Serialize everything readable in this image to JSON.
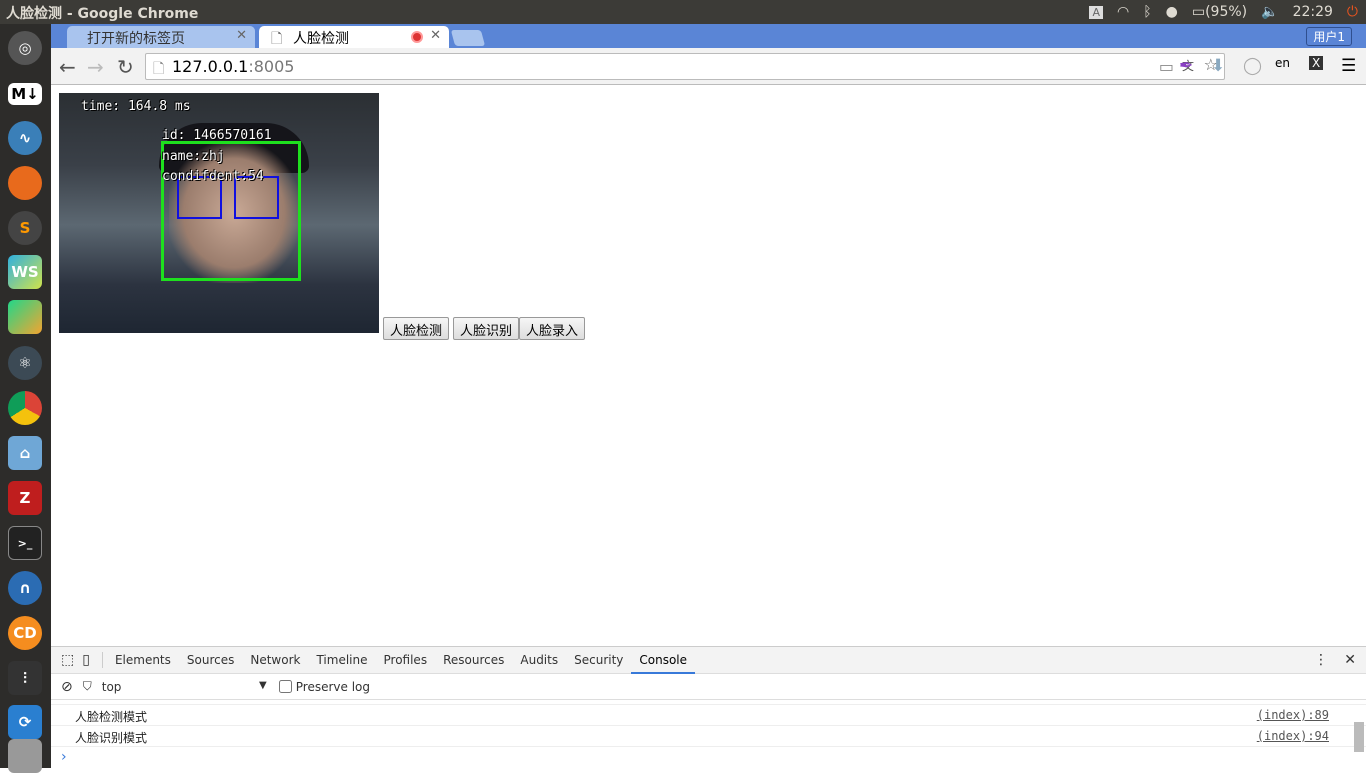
{
  "window": {
    "title": "人脸检测 - Google Chrome"
  },
  "tray": {
    "input_indicator": "A",
    "battery": "(95%)",
    "time": "22:29"
  },
  "launcher": {
    "items": [
      "ubuntu-dash",
      "markdown",
      "system-monitor",
      "firefox",
      "sublime",
      "webstorm",
      "pycharm",
      "atom",
      "chrome",
      "files",
      "filezilla",
      "terminal",
      "wireshark",
      "codeblocks",
      "settings",
      "software-updater",
      "trash"
    ],
    "markdown_label": "M↓",
    "webstorm_label": "WS",
    "codeblocks_label": "CD",
    "sublime_label": "S"
  },
  "tabs": [
    {
      "label": "打开新的标签页"
    },
    {
      "label": "人脸检测",
      "recording": true
    }
  ],
  "user_button": "用户1",
  "address": {
    "host": "127.0.0.1",
    "port": ":8005"
  },
  "page": {
    "overlay": {
      "time": "time: 164.8 ms",
      "id": "id: 1466570161",
      "name": "name:zhj",
      "confidence": "condifdent:54"
    },
    "buttons": [
      "人脸检测",
      "人脸识别",
      "人脸录入"
    ]
  },
  "devtools": {
    "tabs": [
      "Elements",
      "Sources",
      "Network",
      "Timeline",
      "Profiles",
      "Resources",
      "Audits",
      "Security",
      "Console"
    ],
    "active_tab": "Console",
    "context": "top",
    "preserve_log": "Preserve log",
    "preserve_log_checked": false,
    "messages": [
      {
        "text": "人脸检测模式",
        "source": "(index):89"
      },
      {
        "text": "人脸识别模式",
        "source": "(index):94"
      }
    ],
    "prompt": "›"
  },
  "colors": {
    "face_box": "#1ee01e",
    "eye_box": "#1010e0",
    "tab_strip": "#5a85d6",
    "active_tab_underline": "#3879d9"
  }
}
